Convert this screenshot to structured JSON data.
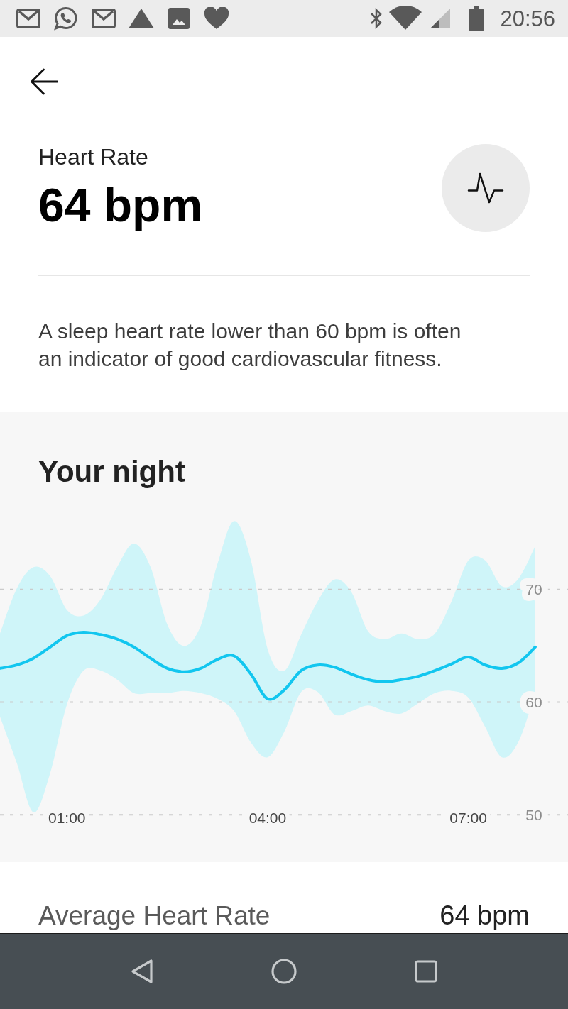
{
  "status_bar": {
    "time": "20:56"
  },
  "header": {
    "title": "Heart Rate",
    "value": "64 bpm"
  },
  "description": "A sleep heart rate lower than 60 bpm is often an indicator of good cardiovascular fitness.",
  "night_section": {
    "title": "Your night",
    "chart_data": {
      "type": "line",
      "x": [
        0,
        0.25,
        0.5,
        0.75,
        1,
        1.25,
        1.5,
        1.75,
        2,
        2.25,
        2.5,
        2.75,
        3,
        3.25,
        3.5,
        3.75,
        4,
        4.25,
        4.5,
        4.75,
        5,
        5.25,
        5.5,
        5.75,
        6,
        6.25,
        6.5,
        6.75,
        7,
        7.25,
        7.5,
        7.75,
        8
      ],
      "xlim": [
        0,
        8.5
      ],
      "ylim": [
        45.8,
        85.8
      ],
      "xticks": [
        {
          "value": 1,
          "label": "01:00"
        },
        {
          "value": 4,
          "label": "04:00"
        },
        {
          "value": 7,
          "label": "07:00"
        }
      ],
      "yticks": [
        50,
        60,
        70
      ],
      "grid": true,
      "series": [
        {
          "color": "#12c6ef",
          "values": [
            63.0,
            63.3,
            63.9,
            64.9,
            65.9,
            66.2,
            66.0,
            65.6,
            64.9,
            63.9,
            63.0,
            62.7,
            63.0,
            63.8,
            64.1,
            62.5,
            60.3,
            61.1,
            62.8,
            63.3,
            63.1,
            62.5,
            62.0,
            61.8,
            62.0,
            62.3,
            62.8,
            63.4,
            64.0,
            63.3,
            63.0,
            63.5,
            64.9
          ]
        }
      ]
    }
  },
  "summary": [
    {
      "label": "Average Heart Rate",
      "value": "64 bpm"
    }
  ]
}
